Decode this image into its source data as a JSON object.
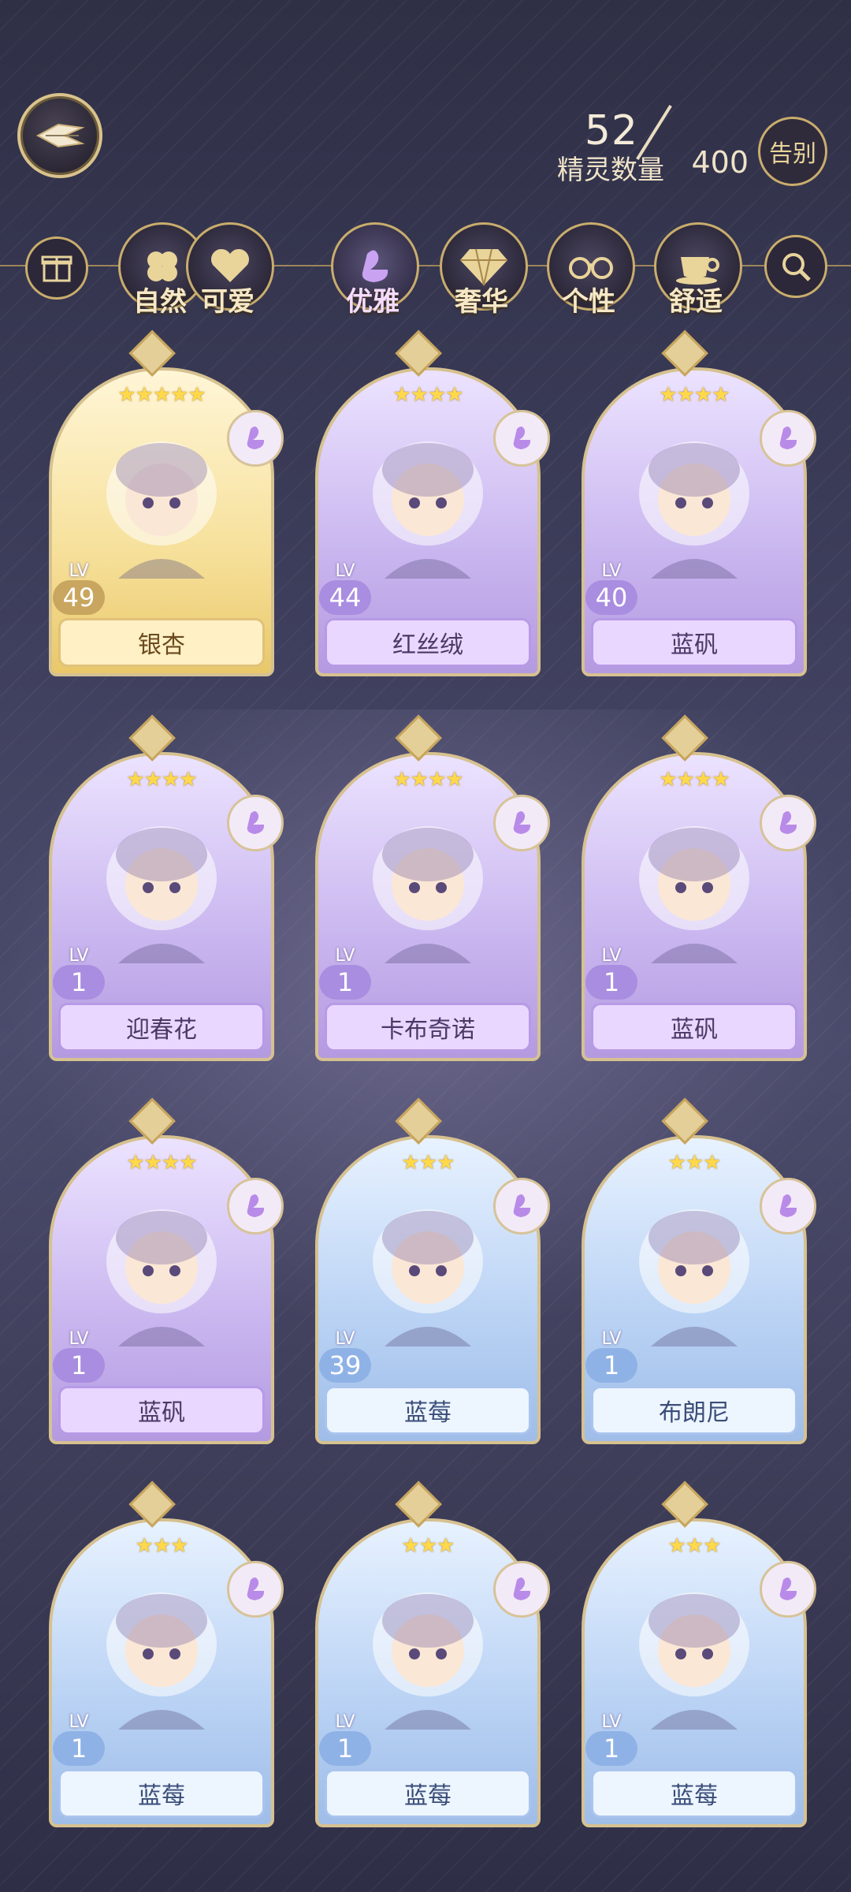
{
  "header": {
    "sprite_count_label": "精灵数量",
    "sprite_count_current": "52",
    "sprite_count_max": "400",
    "farewell_label": "告别"
  },
  "filters": [
    {
      "label": "自然",
      "icon": "clover-icon"
    },
    {
      "label": "可爱",
      "icon": "heart-icon"
    },
    {
      "label": "优雅",
      "icon": "swan-icon",
      "active": true
    },
    {
      "label": "奢华",
      "icon": "diamond-icon"
    },
    {
      "label": "个性",
      "icon": "glasses-icon"
    },
    {
      "label": "舒适",
      "icon": "teacup-icon"
    }
  ],
  "cards": [
    {
      "name": "银杏",
      "level": "49",
      "lv_text": "LV",
      "stars": "★★★★★",
      "theme": "gold"
    },
    {
      "name": "红丝绒",
      "level": "44",
      "lv_text": "LV",
      "stars": "★★★★",
      "theme": "purple"
    },
    {
      "name": "蓝矾",
      "level": "40",
      "lv_text": "LV",
      "stars": "★★★★",
      "theme": "purple"
    },
    {
      "name": "迎春花",
      "level": "1",
      "lv_text": "LV",
      "stars": "★★★★",
      "theme": "purple"
    },
    {
      "name": "卡布奇诺",
      "level": "1",
      "lv_text": "LV",
      "stars": "★★★★",
      "theme": "purple"
    },
    {
      "name": "蓝矾",
      "level": "1",
      "lv_text": "LV",
      "stars": "★★★★",
      "theme": "purple"
    },
    {
      "name": "蓝矾",
      "level": "1",
      "lv_text": "LV",
      "stars": "★★★★",
      "theme": "purple"
    },
    {
      "name": "蓝莓",
      "level": "39",
      "lv_text": "LV",
      "stars": "★★★",
      "theme": "blue"
    },
    {
      "name": "布朗尼",
      "level": "1",
      "lv_text": "LV",
      "stars": "★★★",
      "theme": "blue"
    },
    {
      "name": "蓝莓",
      "level": "1",
      "lv_text": "LV",
      "stars": "★★★",
      "theme": "blue"
    },
    {
      "name": "蓝莓",
      "level": "1",
      "lv_text": "LV",
      "stars": "★★★",
      "theme": "blue"
    },
    {
      "name": "蓝莓",
      "level": "1",
      "lv_text": "LV",
      "stars": "★★★",
      "theme": "blue"
    }
  ],
  "colors": {
    "accent_gold": "#c9ad6d",
    "purple_card": "#c9b6ef",
    "gold_card": "#f6e09a",
    "blue_card": "#b9d2f4"
  }
}
